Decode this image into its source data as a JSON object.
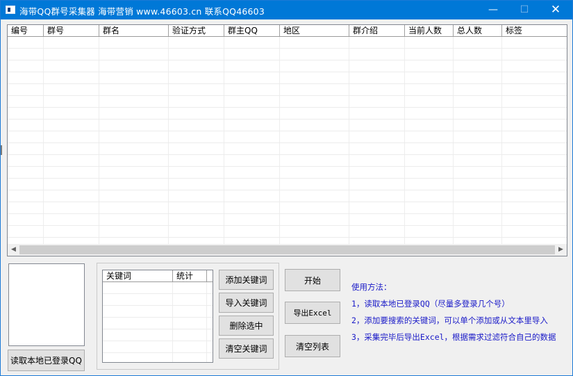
{
  "window": {
    "title": "海带QQ群号采集器    海带营销 www.46603.cn  联系QQ46603",
    "controls": {
      "minimize": "—",
      "maximize": "☐",
      "close": "✕"
    }
  },
  "main_list": {
    "columns": [
      "编号",
      "群号",
      "群名",
      "验证方式",
      "群主QQ",
      "地区",
      "群介绍",
      "当前人数",
      "总人数",
      "标签"
    ],
    "rows": []
  },
  "accounts": {
    "read_button": "读取本地已登录QQ"
  },
  "keywords": {
    "columns": [
      "关键词",
      "统计",
      ""
    ],
    "rows": [],
    "add_button": "添加关键词",
    "import_button": "导入关键词",
    "delete_button": "删除选中",
    "clear_button": "清空关键词"
  },
  "actions": {
    "start": "开始",
    "export": "导出Excel",
    "clear_list": "清空列表"
  },
  "usage": {
    "title": "使用方法：",
    "steps": [
      "1，读取本地已登录QQ（尽量多登录几个号）",
      "2，添加要搜索的关键词，可以单个添加或从文本里导入",
      "3，采集完毕后导出Excel，根据需求过滤符合自己的数据"
    ]
  },
  "colors": {
    "titlebar": "#0078d7",
    "instructions": "#1a1ac8"
  }
}
